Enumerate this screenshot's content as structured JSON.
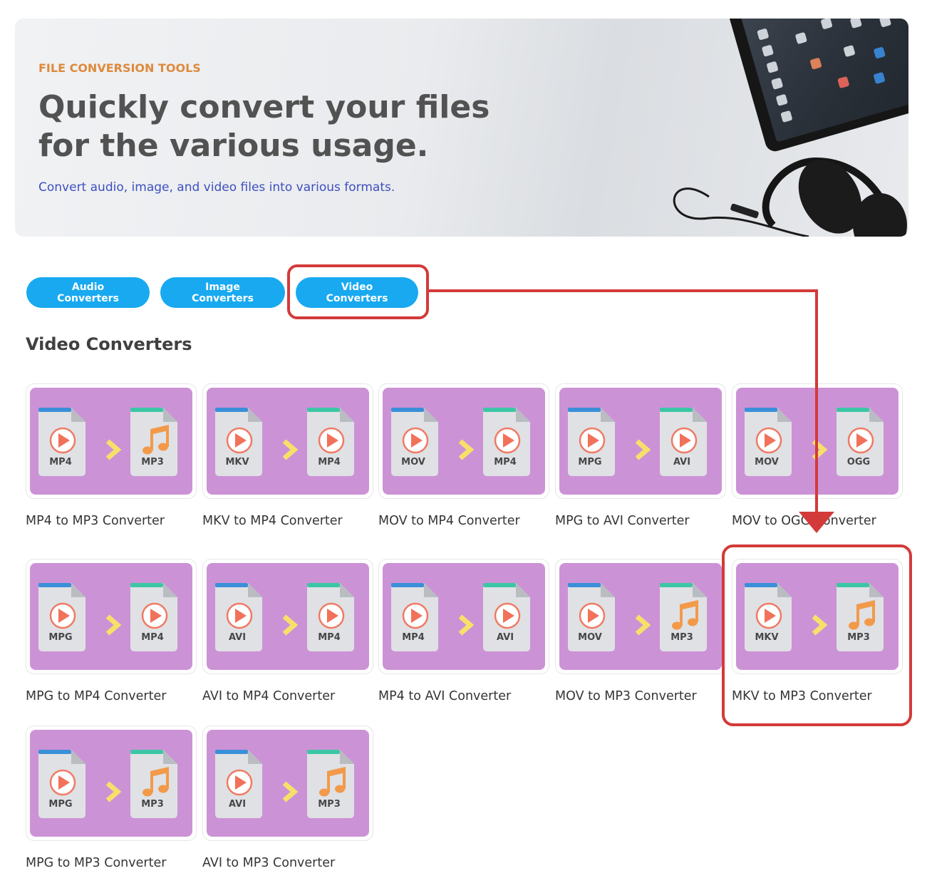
{
  "hero": {
    "eyebrow": "FILE CONVERSION TOOLS",
    "headline": "Quickly convert your files for the various usage.",
    "subtitle": "Convert audio, image, and video files into various formats."
  },
  "categories": [
    {
      "label": "Audio Converters"
    },
    {
      "label": "Image Converters"
    },
    {
      "label": "Video Converters"
    }
  ],
  "section_title": "Video Converters",
  "cards": [
    {
      "label": "MP4 to MP3 Converter",
      "from": "MP4",
      "to": "MP3",
      "from_icon": "play",
      "to_icon": "music"
    },
    {
      "label": "MKV to MP4 Converter",
      "from": "MKV",
      "to": "MP4",
      "from_icon": "play",
      "to_icon": "play"
    },
    {
      "label": "MOV to MP4 Converter",
      "from": "MOV",
      "to": "MP4",
      "from_icon": "play",
      "to_icon": "play"
    },
    {
      "label": "MPG to AVI Converter",
      "from": "MPG",
      "to": "AVI",
      "from_icon": "play",
      "to_icon": "play"
    },
    {
      "label": "MOV to OGG Converter",
      "from": "MOV",
      "to": "OGG",
      "from_icon": "play",
      "to_icon": "play"
    },
    {
      "label": "MPG to MP4 Converter",
      "from": "MPG",
      "to": "MP4",
      "from_icon": "play",
      "to_icon": "play"
    },
    {
      "label": "AVI to MP4 Converter",
      "from": "AVI",
      "to": "MP4",
      "from_icon": "play",
      "to_icon": "play"
    },
    {
      "label": "MP4 to AVI Converter",
      "from": "MP4",
      "to": "AVI",
      "from_icon": "play",
      "to_icon": "play"
    },
    {
      "label": "MOV to MP3 Converter",
      "from": "MOV",
      "to": "MP3",
      "from_icon": "play",
      "to_icon": "music"
    },
    {
      "label": "MKV to MP3 Converter",
      "from": "MKV",
      "to": "MP3",
      "from_icon": "play",
      "to_icon": "music"
    },
    {
      "label": "MPG to MP3 Converter",
      "from": "MPG",
      "to": "MP3",
      "from_icon": "play",
      "to_icon": "music"
    },
    {
      "label": "AVI to MP3 Converter",
      "from": "AVI",
      "to": "MP3",
      "from_icon": "play",
      "to_icon": "music"
    }
  ],
  "colors": {
    "accent": "#18a9f1",
    "tile": "#cc92d6",
    "annotation": "#d33a3a",
    "eyebrow": "#de8a3c",
    "subtitle": "#3e4fbf"
  }
}
